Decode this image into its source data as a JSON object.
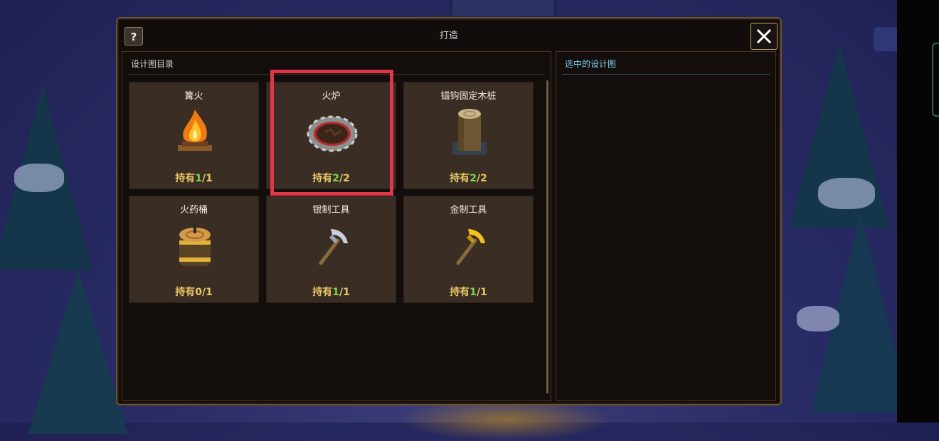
{
  "dialog": {
    "title": "打造",
    "help_label": "?"
  },
  "catalog": {
    "header": "设计图目录",
    "items": [
      {
        "name": "篝火",
        "owned_prefix": "持有",
        "owned": "1",
        "sep": "/",
        "total": "1",
        "icon": "campfire-icon",
        "zero": false
      },
      {
        "name": "火炉",
        "owned_prefix": "持有",
        "owned": "2",
        "sep": "/",
        "total": "2",
        "icon": "furnace-icon",
        "zero": false
      },
      {
        "name": "锚钩固定木桩",
        "owned_prefix": "持有",
        "owned": "2",
        "sep": "/",
        "total": "2",
        "icon": "wooden-stake-icon",
        "zero": false
      },
      {
        "name": "火药桶",
        "owned_prefix": "持有",
        "owned": "0",
        "sep": "/",
        "total": "1",
        "icon": "powder-keg-icon",
        "zero": true
      },
      {
        "name": "银制工具",
        "owned_prefix": "持有",
        "owned": "1",
        "sep": "/",
        "total": "1",
        "icon": "silver-pickaxe-icon",
        "zero": false
      },
      {
        "name": "金制工具",
        "owned_prefix": "持有",
        "owned": "1",
        "sep": "/",
        "total": "1",
        "icon": "gold-pickaxe-icon",
        "zero": false
      }
    ]
  },
  "selected": {
    "header": "选中的设计图"
  },
  "colors": {
    "highlight": "#e2344a",
    "count_yellow": "#e7c766",
    "count_green": "#78d94f"
  }
}
